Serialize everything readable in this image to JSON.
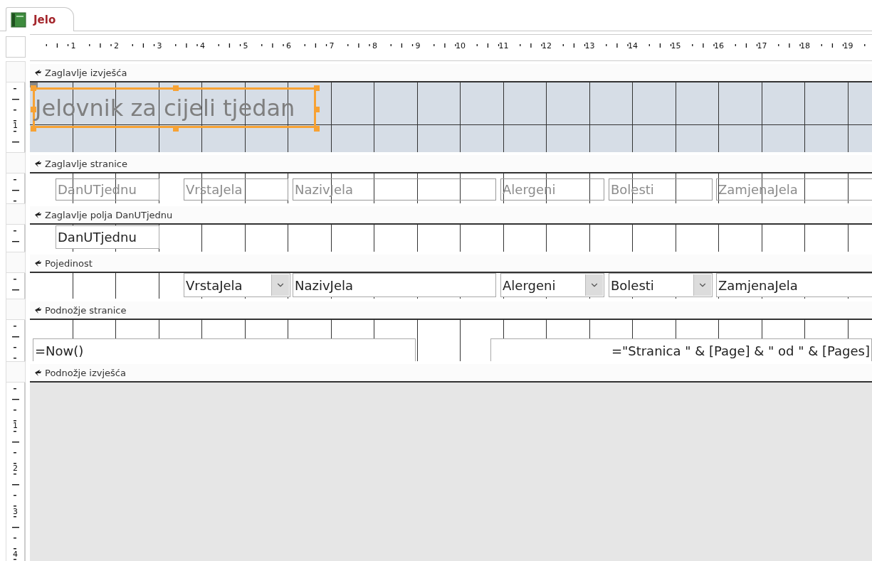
{
  "tab": {
    "title": "Jelo",
    "selected": true
  },
  "ruler_numbers": [
    "1",
    "2",
    "3",
    "4",
    "5",
    "6",
    "7",
    "8",
    "9",
    "10",
    "11",
    "12",
    "13",
    "14",
    "15",
    "16",
    "17",
    "18",
    "19"
  ],
  "sections": [
    {
      "kind": "report_header",
      "title": "Zaglavlje izvješća",
      "ruler_numbers": [
        "1"
      ],
      "controls": [
        {
          "kind": "title",
          "text": "Jelovnik za cijeli tjedan",
          "selected": true
        }
      ]
    },
    {
      "kind": "page_header",
      "title": "Zaglavlje stranice",
      "controls": [
        {
          "kind": "label",
          "text": "DanUTjednu"
        },
        {
          "kind": "label",
          "text": "VrstaJela"
        },
        {
          "kind": "label",
          "text": "NazivJela"
        },
        {
          "kind": "label",
          "text": "Alergeni"
        },
        {
          "kind": "label",
          "text": "Bolesti"
        },
        {
          "kind": "label",
          "text": "ZamjenaJela"
        }
      ]
    },
    {
      "kind": "group_header",
      "title": "Zaglavlje polja DanUTjednu",
      "controls": [
        {
          "kind": "textbox",
          "text": "DanUTjednu"
        }
      ]
    },
    {
      "kind": "detail",
      "title": "Pojedinost",
      "controls": [
        {
          "kind": "combo",
          "text": "VrstaJela"
        },
        {
          "kind": "textbox",
          "text": "NazivJela"
        },
        {
          "kind": "combo",
          "text": "Alergeni"
        },
        {
          "kind": "combo",
          "text": "Bolesti"
        },
        {
          "kind": "textbox",
          "text": "ZamjenaJela"
        }
      ]
    },
    {
      "kind": "page_footer",
      "title": "Podnožje stranice",
      "controls": [
        {
          "kind": "textbox",
          "text": "=Now()"
        },
        {
          "kind": "textbox_right",
          "text": "=\"Stranica \" & [Page] & \" od \" & [Pages]"
        }
      ]
    },
    {
      "kind": "report_footer",
      "title": "Podnožje izvješća"
    }
  ],
  "empty_area_ruler_numbers": [
    "1",
    "2",
    "3",
    "4"
  ]
}
